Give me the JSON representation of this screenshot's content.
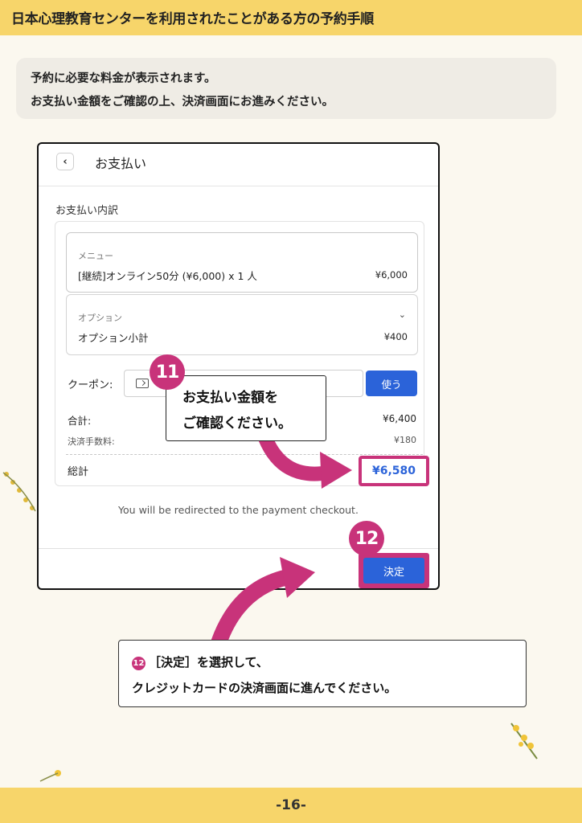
{
  "header": {
    "title": "日本心理教育センターを利用されたことがある方の予約手順"
  },
  "intro": {
    "line1": "予約に必要な料金が表示されます。",
    "line2": "お支払い金額をご確認の上、決済画面にお進みください。"
  },
  "screen": {
    "back_icon": "chevron-left-icon",
    "title": "お支払い",
    "section_title": "お支払い内訳",
    "menu": {
      "label": "メニュー",
      "item": "[継続]オンライン50分 (¥6,000) x 1 人",
      "price": "¥6,000"
    },
    "option": {
      "label": "オプション",
      "item": "オプション小計",
      "price": "¥400"
    },
    "coupon": {
      "label": "クーポン:",
      "button": "使う"
    },
    "subtotal": {
      "label": "合計:",
      "value": "¥6,400"
    },
    "fee": {
      "label": "決済手数料:",
      "value": "¥180"
    },
    "total": {
      "label": "総計",
      "value": "¥6,580"
    },
    "redirect_note": "You will be redirected to the payment checkout.",
    "decide_button": "決定"
  },
  "callout11": {
    "badge": "11",
    "line1": "お支払い金額を",
    "line2": "ご確認ください。"
  },
  "callout12": {
    "badge": "12",
    "line1_badge": "12",
    "line1": "［決定］を選択して、",
    "line2": "クレジットカードの決済画面に進んでください。"
  },
  "colors": {
    "accent_pink": "#c8337a",
    "button_blue": "#2b63d9",
    "band_yellow": "#f7d56a"
  },
  "footer": {
    "page": "-16-"
  }
}
